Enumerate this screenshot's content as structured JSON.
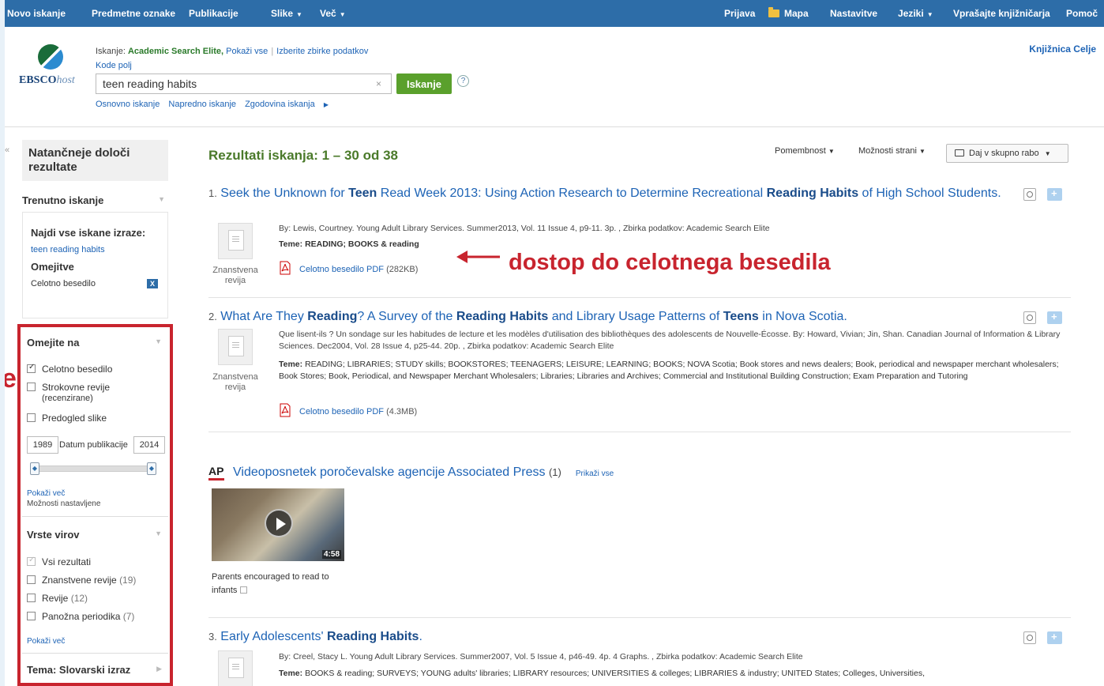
{
  "topnav": {
    "left": [
      "Novo iskanje",
      "Predmetne oznake",
      "Publikacije",
      "Slike",
      "Več"
    ],
    "right": [
      "Prijava",
      "Mapa",
      "Nastavitve",
      "Jeziki",
      "Vprašajte knjižničarja",
      "Pomoč"
    ]
  },
  "logo": {
    "ebsco": "EBSCO",
    "host": "host"
  },
  "search": {
    "prefix": "Iskanje:",
    "database": "Academic Search Elite,",
    "show_all": "Pokaži vse",
    "choose_db": "Izberite zbirke podatkov",
    "field_codes": "Kode polj",
    "query": "teen reading habits",
    "button": "Iskanje",
    "help": "?",
    "links": [
      "Osnovno iskanje",
      "Napredno iskanje",
      "Zgodovina iskanja"
    ]
  },
  "library": "Knjižnica Celje",
  "sidebar": {
    "refine_title": "Natančneje določi rezultate",
    "current_head": "Trenutno iskanje",
    "find_all": "Najdi vse iskane izraze:",
    "term": "teen reading habits",
    "limiters_head": "Omejitve",
    "limiter_value": "Celotno besedilo",
    "limit_to_head": "Omejite na",
    "limit_options": [
      "Celotno besedilo",
      "Strokovne revije",
      "(recenzirane)",
      "Predogled slike"
    ],
    "date_from": "1989",
    "date_label": "Datum publikacije",
    "date_to": "2014",
    "show_more": "Pokaži več",
    "options_set": "Možnosti nastavljene",
    "source_types_head": "Vrste virov",
    "source_all": "Vsi rezultati",
    "sources": [
      {
        "name": "Znanstvene revije",
        "count": "(19)"
      },
      {
        "name": "Revije",
        "count": "(12)"
      },
      {
        "name": "Panožna periodika",
        "count": "(7)"
      }
    ],
    "show_more_2": "Pokaži več",
    "subject_head": "Tema: Slovarski izraz",
    "side_letter": "e"
  },
  "results": {
    "title": "Rezultati iskanja: 1 – 30 od 38",
    "relevance": "Pomembnost",
    "page_options": "Možnosti strani",
    "share": "Daj v skupno rabo",
    "items": [
      {
        "num": "1.",
        "t1": "Seek the Unknown for ",
        "b1": "Teen",
        "t2": " Read Week 2013: Using Action Research to Determine Recreational ",
        "b2": "Reading Habits",
        "t3": " of High School Students.",
        "meta": "By: Lewis, Courtney. Young Adult Library Services. Summer2013, Vol. 11 Issue 4, p9-11. 3p. , Zbirka podatkov: Academic Search Elite",
        "subj_label": "Teme:",
        "subjects": "READING; BOOKS & reading",
        "pdf": "Celotno besedilo PDF",
        "size": "(282KB)",
        "type": "Znanstvena revija"
      },
      {
        "num": "2.",
        "t1": "What Are They ",
        "b1": "Reading",
        "t2": "? A Survey of the ",
        "b2": "Reading Habits",
        "t3": " and Library Usage Patterns of ",
        "b3": "Teens",
        "t4": " in Nova Scotia.",
        "meta": "Que lisent-ils ? Un sondage sur les habitudes de lecture et les modèles d'utilisation des bibliothèques des adolescents de Nouvelle-Écosse. By: Howard, Vivian; Jin, Shan. Canadian Journal of Information & Library Sciences. Dec2004, Vol. 28 Issue 4, p25-44. 20p. , Zbirka podatkov: Academic Search Elite",
        "subj_label": "Teme:",
        "subjects": "READING; LIBRARIES; STUDY skills; BOOKSTORES; TEENAGERS; LEISURE; LEARNING; BOOKS; NOVA Scotia; Book stores and news dealers; Book, periodical and newspaper merchant wholesalers; Book Stores; Book, Periodical, and Newspaper Merchant Wholesalers; Libraries; Libraries and Archives; Commercial and Institutional Building Construction; Exam Preparation and Tutoring",
        "pdf": "Celotno besedilo PDF",
        "size": "(4.3MB)",
        "type": "Znanstvena revija"
      },
      {
        "num": "3.",
        "t1": "Early Adolescents' ",
        "b1": "Reading Habits",
        "t2": ".",
        "meta": "By: Creel, Stacy L. Young Adult Library Services. Summer2007, Vol. 5 Issue 4, p46-49. 4p. 4 Graphs. , Zbirka podatkov: Academic Search Elite",
        "subj_label": "Teme:",
        "subjects": "BOOKS & reading; SURVEYS; YOUNG adults' libraries; LIBRARY resources; UNIVERSITIES & colleges; LIBRARIES & industry; UNITED States; Colleges, Universities,"
      }
    ]
  },
  "video": {
    "ap": "AP",
    "title": "Videoposnetek poročevalske agencije Associated Press",
    "count": "(1)",
    "show_all": "Prikaži vse",
    "duration": "4:58",
    "caption": "Parents encouraged to read to infants"
  },
  "annotation": "dostop do celotnega besedila",
  "colors": {
    "nav": "#2d6da8",
    "accent_green": "#5aa02c",
    "annotation_red": "#c8242e",
    "link": "#1d63b5"
  }
}
